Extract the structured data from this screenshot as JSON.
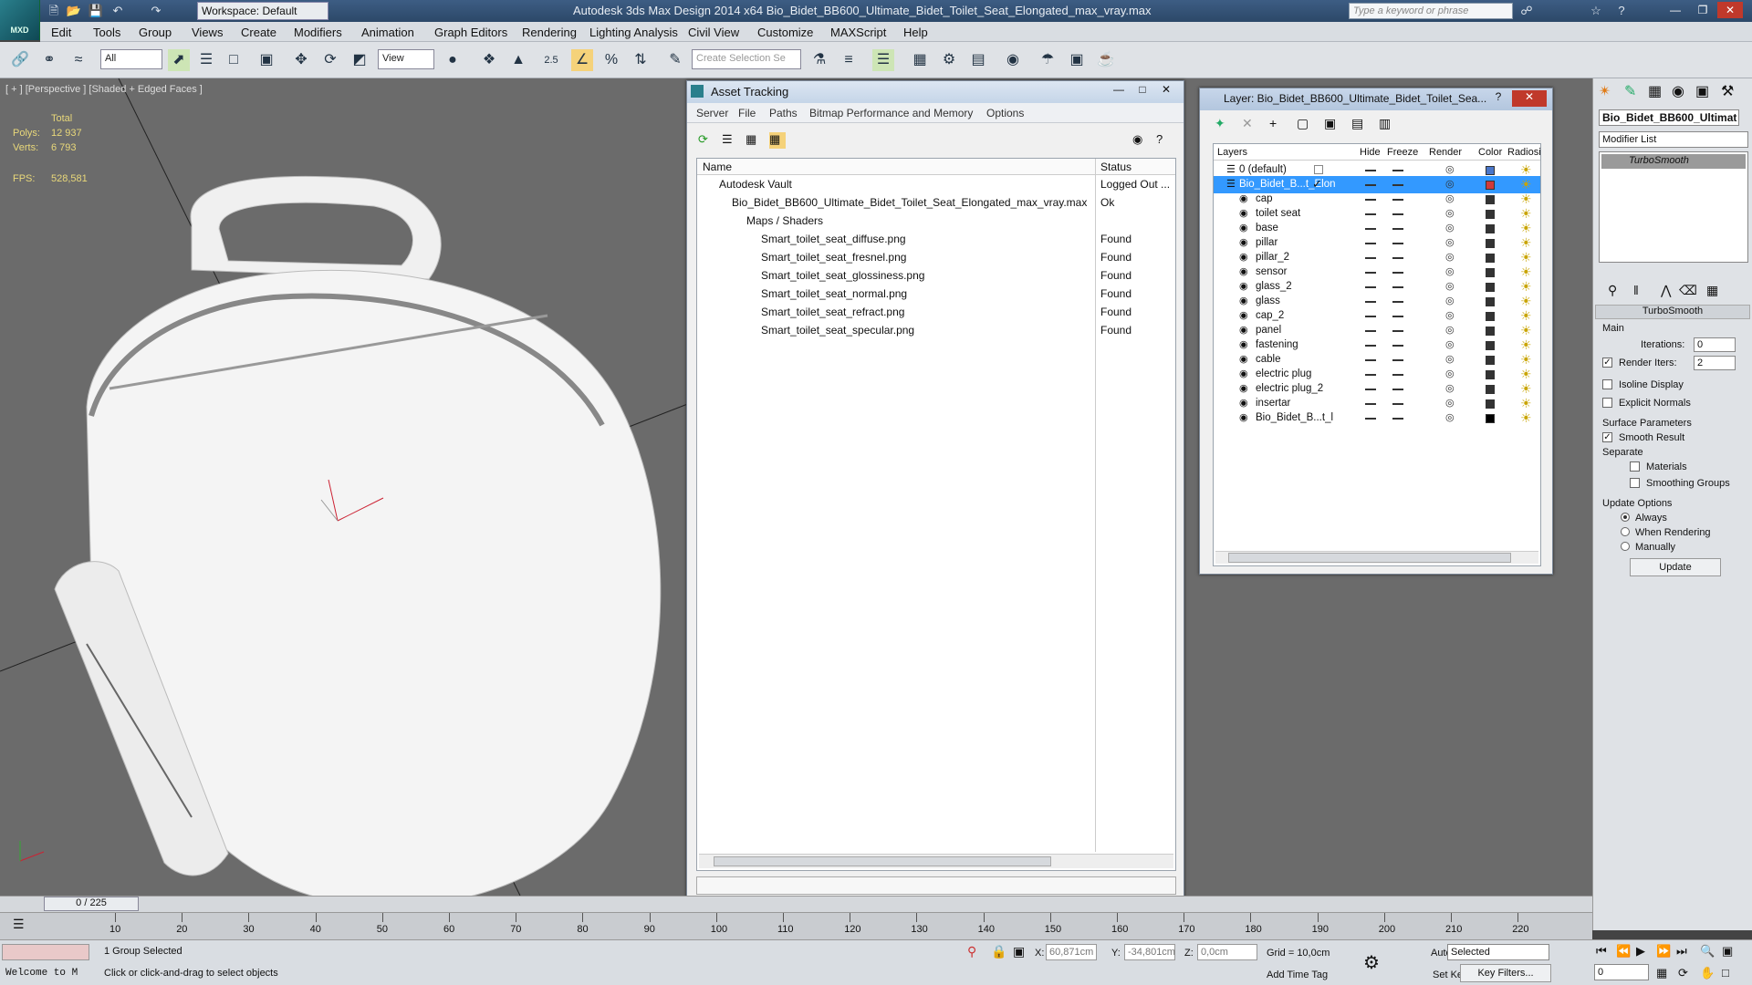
{
  "app": {
    "title": "Autodesk 3ds Max Design 2014 x64    Bio_Bidet_BB600_Ultimate_Bidet_Toilet_Seat_Elongated_max_vray.max",
    "logo": "MXD",
    "workspace": "Workspace: Default",
    "search_placeholder": "Type a keyword or phrase"
  },
  "menu": [
    "Edit",
    "Tools",
    "Group",
    "Views",
    "Create",
    "Modifiers",
    "Animation",
    "Graph Editors",
    "Rendering",
    "Lighting Analysis",
    "Civil View",
    "Customize",
    "MAXScript",
    "Help"
  ],
  "toolbar": {
    "filter": "All",
    "refcoord": "View",
    "selset_placeholder": "Create Selection Se",
    "snap_value": "2.5"
  },
  "viewport": {
    "label": "[ + ] [Perspective ] [Shaded + Edged Faces ]",
    "total_label": "Total",
    "polys_label": "Polys:",
    "polys": "12 937",
    "verts_label": "Verts:",
    "verts": "6 793",
    "fps_label": "FPS:",
    "fps": "528,581"
  },
  "asset_tracking": {
    "title": "Asset Tracking",
    "menu": [
      "Server",
      "File",
      "Paths",
      "Bitmap Performance and Memory",
      "Options"
    ],
    "col_name": "Name",
    "col_status": "Status",
    "rows": [
      {
        "name": "Autodesk Vault",
        "status": "Logged Out ..."
      },
      {
        "name": "Bio_Bidet_BB600_Ultimate_Bidet_Toilet_Seat_Elongated_max_vray.max",
        "status": "Ok"
      },
      {
        "name": "Maps / Shaders",
        "status": ""
      },
      {
        "name": "Smart_toilet_seat_diffuse.png",
        "status": "Found"
      },
      {
        "name": "Smart_toilet_seat_fresnel.png",
        "status": "Found"
      },
      {
        "name": "Smart_toilet_seat_glossiness.png",
        "status": "Found"
      },
      {
        "name": "Smart_toilet_seat_normal.png",
        "status": "Found"
      },
      {
        "name": "Smart_toilet_seat_refract.png",
        "status": "Found"
      },
      {
        "name": "Smart_toilet_seat_specular.png",
        "status": "Found"
      }
    ]
  },
  "layer_window": {
    "title": "Layer: Bio_Bidet_BB600_Ultimate_Bidet_Toilet_Sea...",
    "cols": [
      "Layers",
      "Hide",
      "Freeze",
      "Render",
      "Color",
      "Radiosi"
    ],
    "rows": [
      {
        "name": "0 (default)",
        "color": "#4a76c9"
      },
      {
        "name": "Bio_Bidet_B...t_Elon",
        "color": "#d03a3a"
      },
      {
        "name": "cap",
        "color": "#333333"
      },
      {
        "name": "toilet seat",
        "color": "#333333"
      },
      {
        "name": "base",
        "color": "#333333"
      },
      {
        "name": "pillar",
        "color": "#333333"
      },
      {
        "name": "pillar_2",
        "color": "#333333"
      },
      {
        "name": "sensor",
        "color": "#333333"
      },
      {
        "name": "glass_2",
        "color": "#333333"
      },
      {
        "name": "glass",
        "color": "#333333"
      },
      {
        "name": "cap_2",
        "color": "#333333"
      },
      {
        "name": "panel",
        "color": "#333333"
      },
      {
        "name": "fastening",
        "color": "#333333"
      },
      {
        "name": "cable",
        "color": "#333333"
      },
      {
        "name": "electric plug",
        "color": "#333333"
      },
      {
        "name": "electric plug_2",
        "color": "#333333"
      },
      {
        "name": "insertar",
        "color": "#333333"
      },
      {
        "name": "Bio_Bidet_B...t_l",
        "color": "#000000"
      }
    ]
  },
  "command_panel": {
    "object_name": "Bio_Bidet_BB600_Ultimat",
    "modifier_list": "Modifier List",
    "stack_item": "TurboSmooth",
    "rollout": "TurboSmooth",
    "main": "Main",
    "iterations_label": "Iterations:",
    "iterations": "0",
    "render_iters_label": "Render Iters:",
    "render_iters": "2",
    "isoline": "Isoline Display",
    "explicit": "Explicit Normals",
    "surface": "Surface Parameters",
    "smooth_result": "Smooth Result",
    "separate": "Separate",
    "materials": "Materials",
    "smoothing_groups": "Smoothing Groups",
    "update_options": "Update Options",
    "always": "Always",
    "when_rendering": "When Rendering",
    "manually": "Manually",
    "update": "Update"
  },
  "timeline": {
    "frame": "0 / 225",
    "ticks": [
      "10",
      "20",
      "30",
      "40",
      "50",
      "60",
      "70",
      "80",
      "90",
      "100",
      "110",
      "120",
      "130",
      "140",
      "150",
      "160",
      "170",
      "180",
      "190",
      "200",
      "210",
      "220"
    ]
  },
  "status": {
    "welcome": "Welcome to M",
    "selected": "1 Group Selected",
    "prompt": "Click or click-and-drag to select objects",
    "x_label": "X:",
    "x": "60,871cm",
    "y_label": "Y:",
    "y": "-34,801cm",
    "z_label": "Z:",
    "z": "0,0cm",
    "grid": "Grid = 10,0cm",
    "add_time_tag": "Add Time Tag",
    "auto_key": "Auto Key",
    "set_key": "Set Key",
    "key_mode": "Selected",
    "key_filters": "Key Filters...",
    "frame_value": "0"
  }
}
